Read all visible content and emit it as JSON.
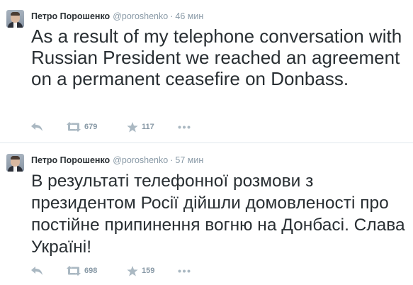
{
  "tweets": [
    {
      "fullname": "Петро Порошенко",
      "username": "@poroshenko",
      "separator": "·",
      "time": "46 мин",
      "text": "As a result of my telephone conversation with Russian President we reached an agreement on a permanent ceasefire on Donbass.",
      "retweet_count": "679",
      "favorite_count": "117"
    },
    {
      "fullname": "Петро Порошенко",
      "username": "@poroshenko",
      "separator": "·",
      "time": "57 мин",
      "text": "В результаті телефонної розмови з президентом Росії дійшли домовленості про постійне припинення вогню на Донбасі. Слава Україні!",
      "retweet_count": "698",
      "favorite_count": "159"
    }
  ],
  "icons": {
    "reply": "reply-icon",
    "retweet": "retweet-icon",
    "favorite": "star-icon",
    "more": "more-icon"
  },
  "colors": {
    "text": "#292f33",
    "meta": "#8899a6",
    "action_icons": "#aab8c2",
    "divider": "#e1e8ed"
  }
}
